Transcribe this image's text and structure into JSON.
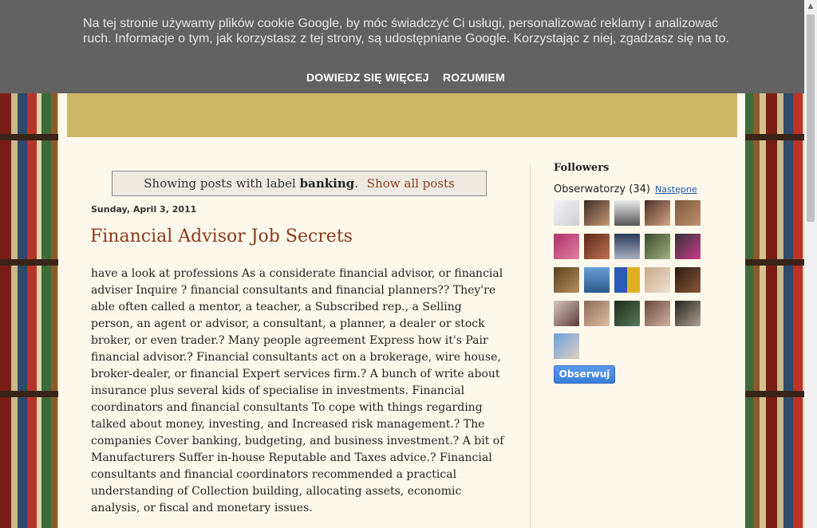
{
  "cookie": {
    "text": "Na tej stronie używamy plików cookie Google, by móc świadczyć Ci usługi, personalizować reklamy i analizować ruch. Informacje o tym, jak korzystasz z tej strony, są udostępniane Google. Korzystając z niej, zgadzasz się na to.",
    "learn_more": "DOWIEDZ SIĘ WIĘCEJ",
    "accept": "ROZUMIEM"
  },
  "status": {
    "prefix": "Showing posts with label",
    "label": "banking",
    "suffix": ".",
    "show_all": "Show all posts"
  },
  "post": {
    "date": "Sunday, April 3, 2011",
    "title": "Financial Advisor Job Secrets",
    "body": "have a look at professions As a considerate financial advisor, or financial adviser Inquire ? financial consultants and financial planners?? They're able often called a mentor, a teacher, a Subscribed rep., a Selling person, an agent or advisor, a consultant, a planner, a dealer or stock broker, or even trader.? Many people agreement Express how it's Pair financial advisor.? Financial consultants act on a brokerage, wire house, broker-dealer, or financial Expert services firm.? A bunch of write about insurance plus several kids of specialise in investments. Financial coordinators and financial consultants To cope with things regarding talked about money, investing, and Increased risk management.? The companies Cover banking, budgeting, and business investment.? A bit of Manufacturers Suffer in-house Reputable and Taxes advice.? Financial consultants and financial coordinators recommended a practical understanding of Collection building, allocating assets, economic analysis, or fiscal and monetary issues."
  },
  "sidebar": {
    "followers_title": "Followers",
    "observers_label": "Obserwatorzy (34)",
    "next_label": "Następne",
    "follow_button": "Obserwuj"
  },
  "colors": {
    "cookie_bg": "#626262",
    "header_band": "#cdb668",
    "page_bg": "#fdf8ec",
    "title_color": "#8b3a1a",
    "follow_button": "#4a8be6"
  }
}
